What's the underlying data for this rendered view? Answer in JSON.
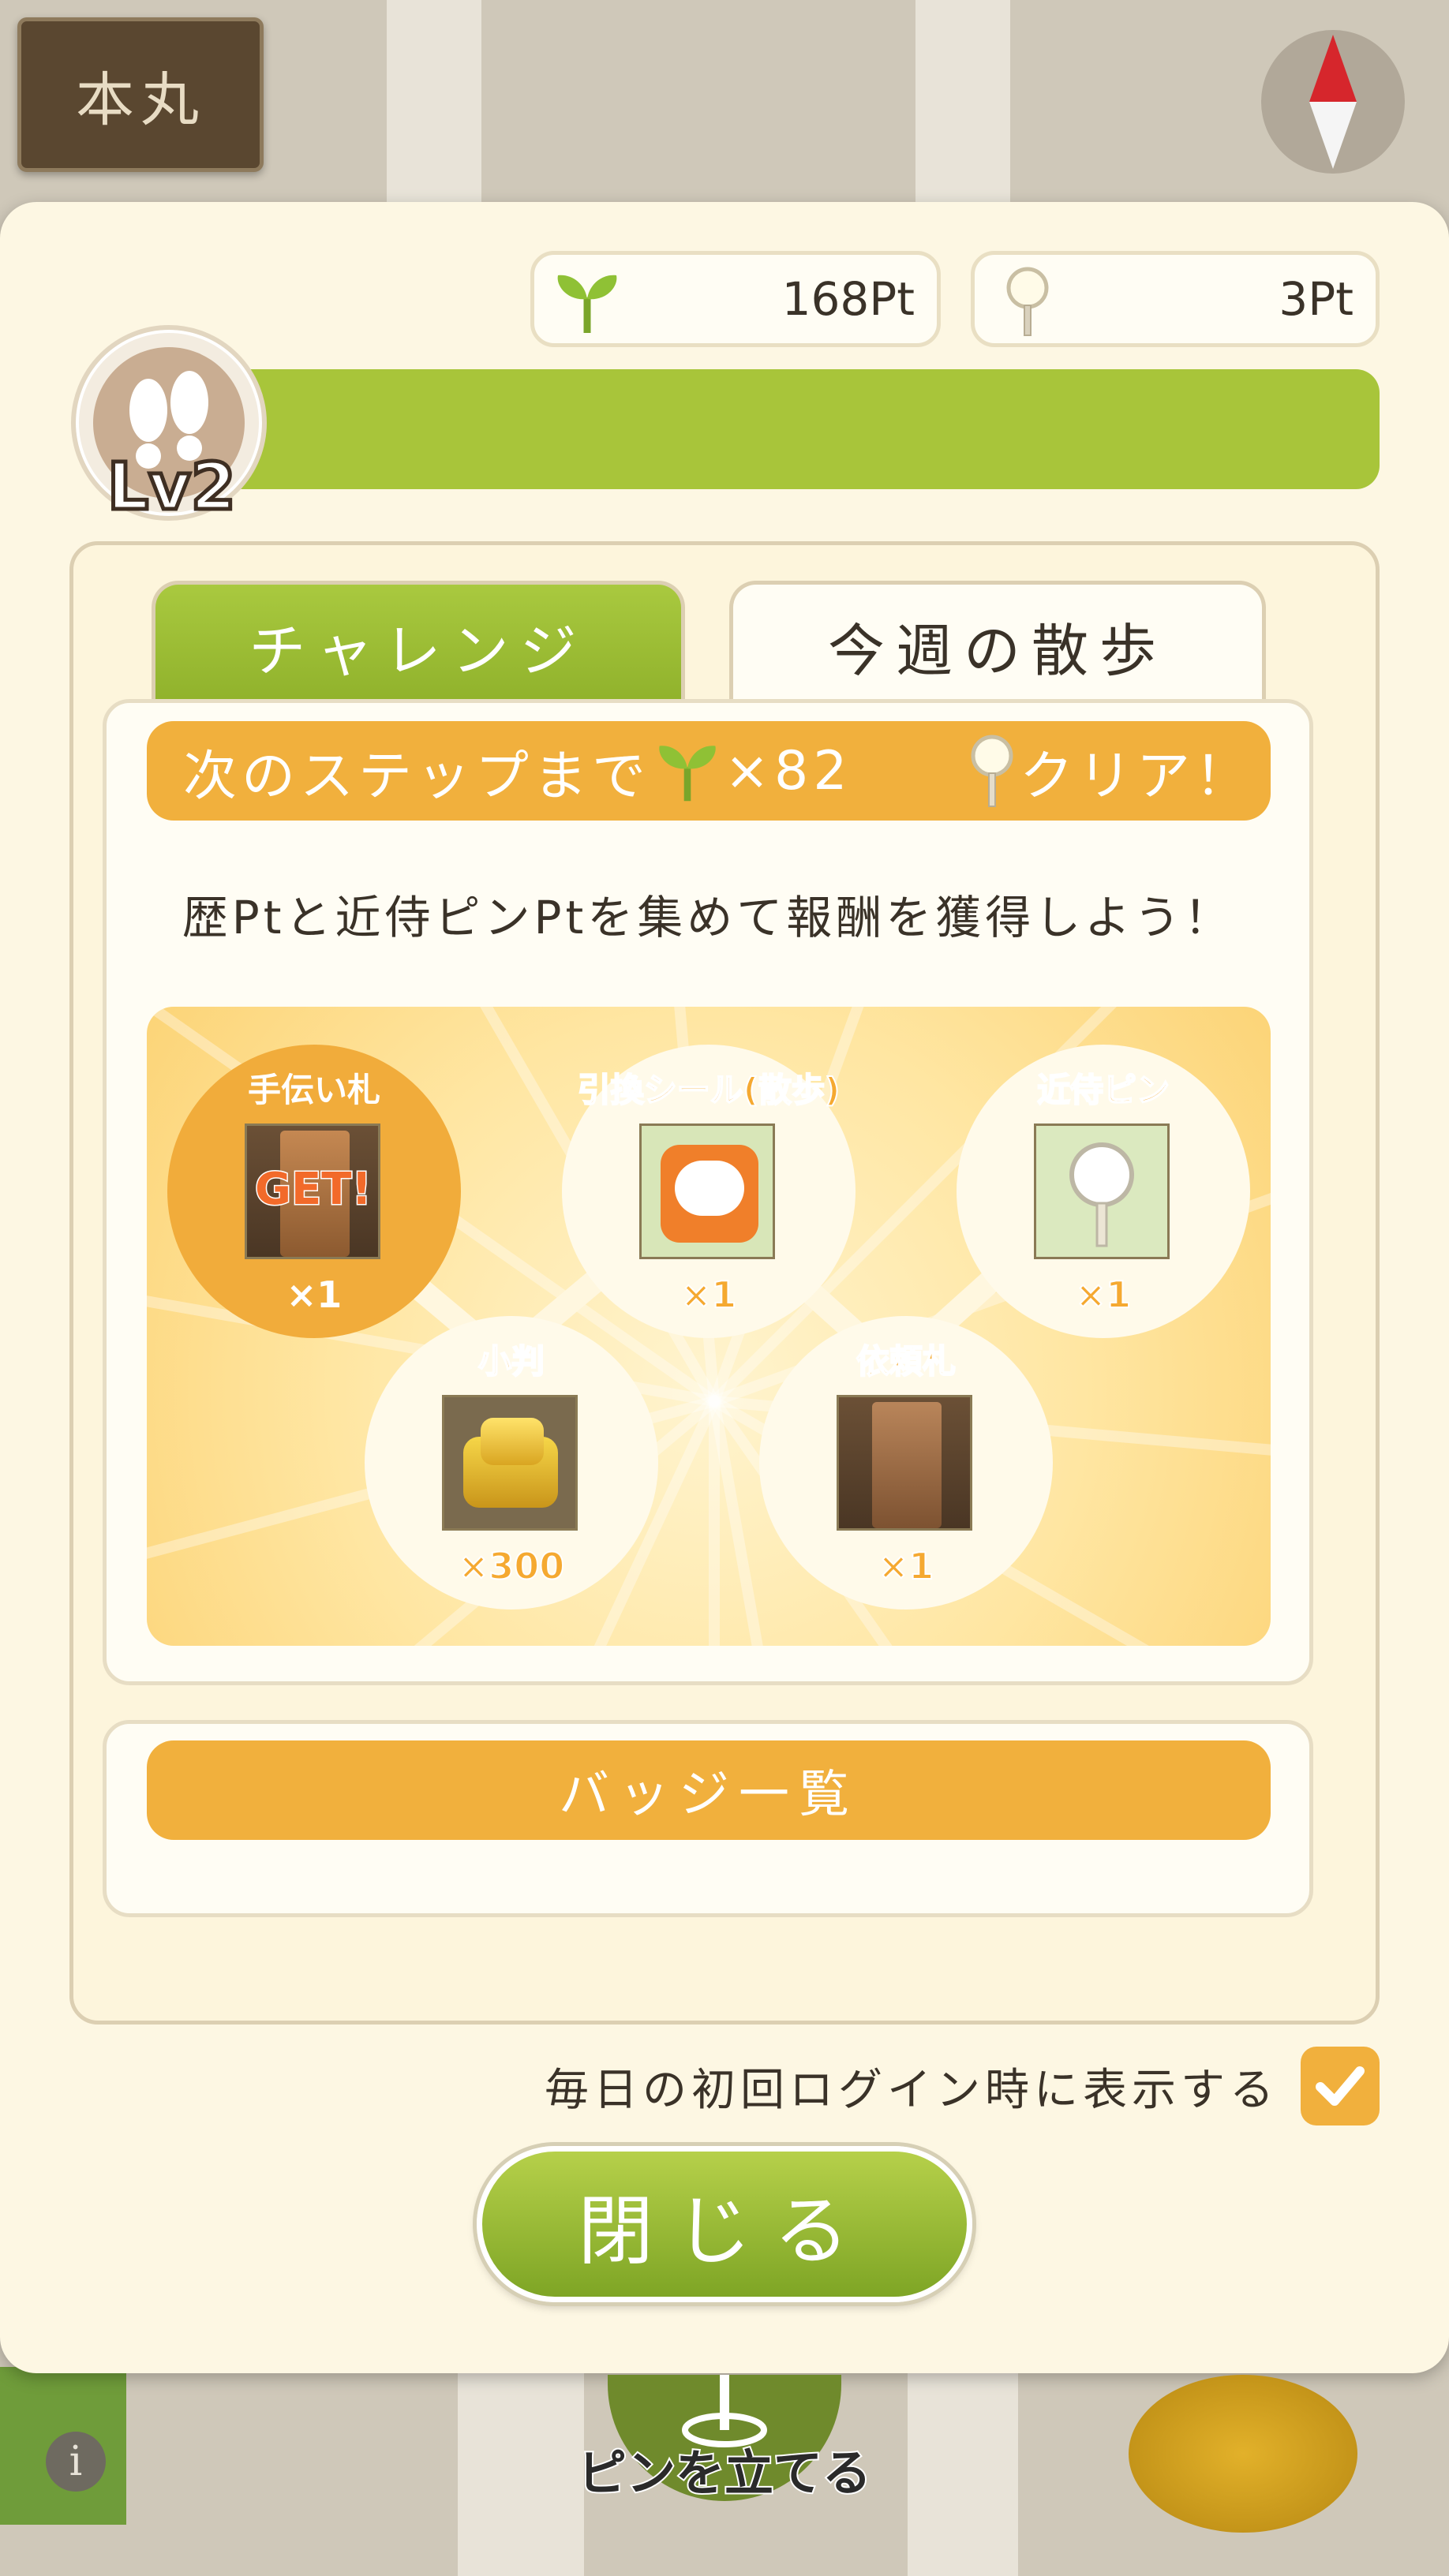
{
  "map": {
    "location_button": "本丸",
    "pin_button_label": "ピンを立てる",
    "info_icon": "i"
  },
  "points": {
    "sprout_pt": "168Pt",
    "pin_pt": "3Pt"
  },
  "level": {
    "label": "Lv2"
  },
  "tabs": {
    "challenge": "チャレンジ",
    "weekly_walk": "今週の散歩"
  },
  "step": {
    "prefix": "次のステップまで",
    "count": "×82",
    "clear": "クリア！"
  },
  "description": "歴Ptと近侍ピンPtを集めて報酬を獲得しよう！",
  "rewards": [
    {
      "label": "手伝い札",
      "count": "×1",
      "overlay": "GET!",
      "got": true
    },
    {
      "label": "引換シール(散歩)",
      "count": "×1",
      "got": false
    },
    {
      "label": "近侍ピン",
      "count": "×1",
      "got": false
    },
    {
      "label": "小判",
      "count": "×300",
      "got": false
    },
    {
      "label": "依頼札",
      "count": "×1",
      "got": false
    }
  ],
  "badge_button": "バッジ一覧",
  "login_option": {
    "label": "毎日の初回ログイン時に表示する",
    "checked": true
  },
  "close_button": "閉じる",
  "colors": {
    "accent_orange": "#f1b03d",
    "accent_green": "#a8c53a",
    "panel_bg": "#fdf7e3"
  }
}
